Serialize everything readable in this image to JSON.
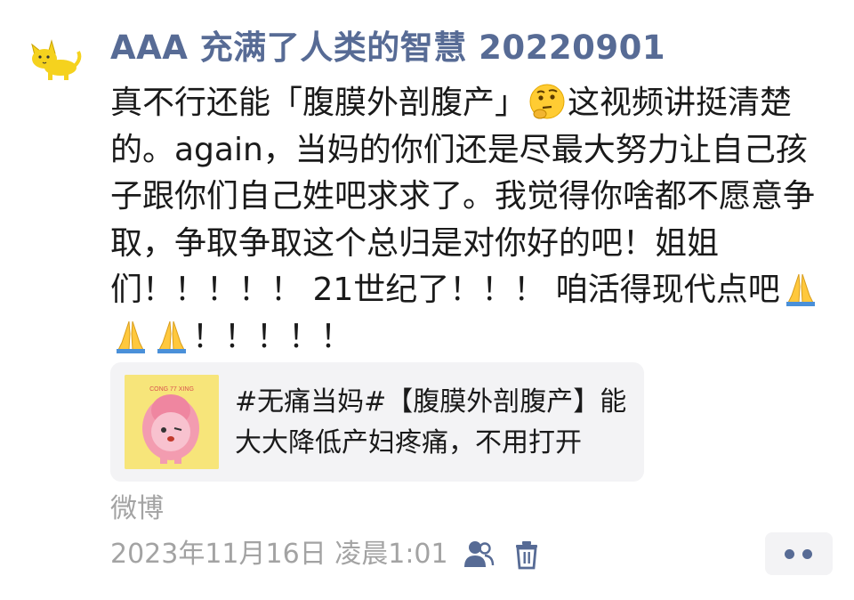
{
  "post": {
    "author": "AAA 充满了人类的智慧 20220901",
    "avatar_icon": "yellow-cat-icon",
    "text": {
      "part1": "真不行还能「腹膜外剖腹产」",
      "emoji1": "thinking-face-emoji",
      "part2": "这视频讲挺清楚的。again，当妈的你们还是尽最大努力让自己孩子跟你们自己姓吧求求了。我觉得你啥都不愿意争取，争取争取这个总归是对你好的吧！姐姐们！！！！！ 21世纪了！！！ 咱活得现代点吧",
      "emoji2": "folded-hands-emoji",
      "part3": "！！！！！"
    },
    "link_card": {
      "thumbnail_icon": "cartoon-character-thumbnail",
      "thumbnail_caption": "CONG  77  XING",
      "title": "#无痛当妈#【腹膜外剖腹产】能大大降低产妇疼痛，不用打开"
    },
    "source": "微博",
    "timestamp": "2023年11月16日 凌晨1:01",
    "actions": {
      "visibility_icon": "people-icon",
      "delete_icon": "trash-icon",
      "more_icon": "more-dots-icon"
    }
  },
  "colors": {
    "author": "#576b95",
    "meta": "#a3a3a3",
    "card_bg": "#f3f3f5",
    "thumbnail_bg": "#f7e57a"
  }
}
